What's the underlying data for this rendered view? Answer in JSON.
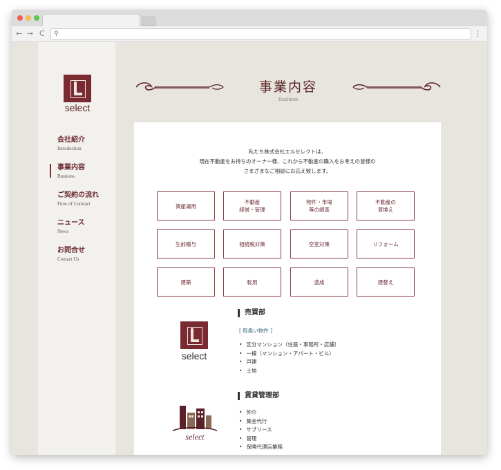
{
  "browser": {
    "back": "←",
    "forward": "→",
    "reload": "C",
    "search_glyph": "⚲",
    "menu_glyph": "⋮"
  },
  "logo_text": "select",
  "nav": [
    {
      "jp": "会社紹介",
      "en": "Introduction",
      "active": false
    },
    {
      "jp": "事業内容",
      "en": "Business",
      "active": true
    },
    {
      "jp": "ご契約の流れ",
      "en": "Flow of Contract",
      "active": false
    },
    {
      "jp": "ニュース",
      "en": "News",
      "active": false
    },
    {
      "jp": "お問合せ",
      "en": "Contact Us",
      "active": false
    }
  ],
  "heading": {
    "title": "事業内容",
    "subtitle": "Business"
  },
  "intro": [
    "私たち株式会社エルセレクトは、",
    "現在不動産をお持ちのオーナー様、これから不動産の購入をお考えの皆様の",
    "さまざまなご相談にお応え致します。"
  ],
  "services": [
    [
      "資産運用"
    ],
    [
      "不動産",
      "経営・管理"
    ],
    [
      "物件・市場",
      "等の調査"
    ],
    [
      "不動産の",
      "買換え"
    ],
    [
      "生前贈与"
    ],
    [
      "相続税対策"
    ],
    [
      "空室対策"
    ],
    [
      "リフォーム"
    ],
    [
      "建築"
    ],
    [
      "転用"
    ],
    [
      "造成"
    ],
    [
      "建替え"
    ]
  ],
  "sales": {
    "title": "売買部",
    "tag": "[ 取扱い物件 ]",
    "items": [
      "区分マンション（住居・事務所・店舗）",
      "一棟（マンション・アパート・ビル）",
      "戸建",
      "土地"
    ],
    "logo_text": "select"
  },
  "rental": {
    "title": "賃貸管理部",
    "items": [
      "仲介",
      "集金代行",
      "サブリース",
      "管理",
      "保険代理店業務"
    ],
    "logo_text": "select"
  },
  "colors": {
    "brand": "#7a2a31",
    "accent_text": "#6b2a32",
    "tag": "#3a6b8a"
  }
}
